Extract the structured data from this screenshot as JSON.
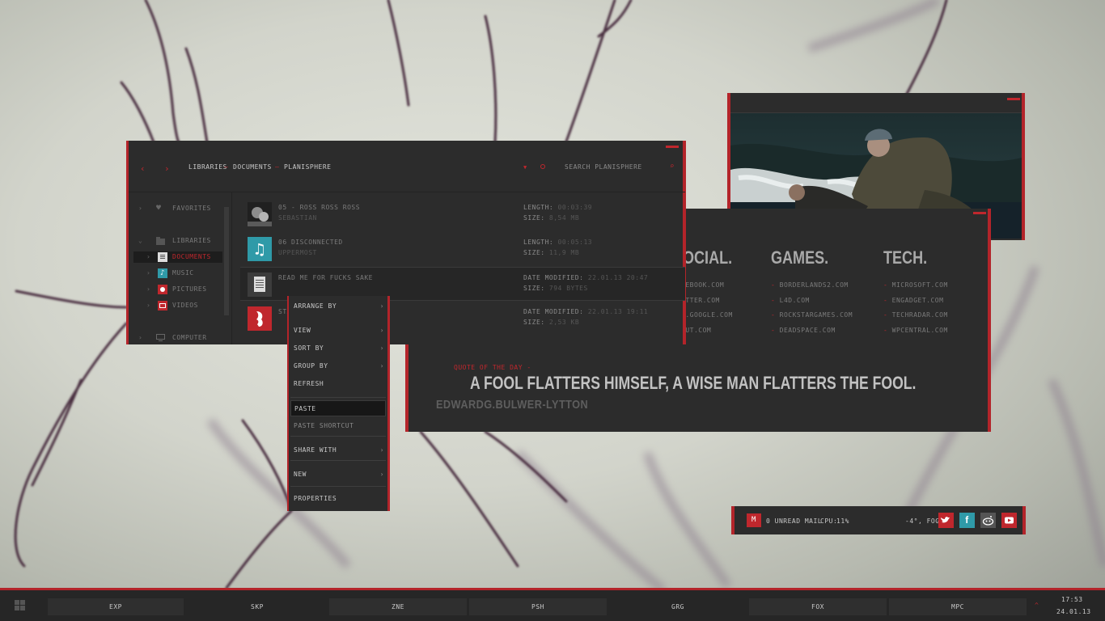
{
  "explorer": {
    "nav_back": "‹",
    "nav_forward": "›",
    "breadcrumb": [
      "LIBRARIES",
      "DOCUMENTS",
      "PLANISPHERE"
    ],
    "breadcrumb_sep": "–",
    "search_label": "SEARCH PLANISPHERE",
    "sidebar": {
      "favorites": "FAVORITES",
      "libraries": "LIBRARIES",
      "documents": "DOCUMENTS",
      "music": "MUSIC",
      "pictures": "PICTURES",
      "videos": "VIDEOS",
      "computer": "COMPUTER"
    },
    "files": [
      {
        "name": "05 - ROSS ROSS ROSS",
        "sub": "SEBASTIAN",
        "k1": "LENGTH:",
        "v1": "00:03:39",
        "k2": "SIZE:",
        "v2": "8,54 MB",
        "icon": "album-art-icon"
      },
      {
        "name": "06 DISCONNECTED",
        "sub": "UPPERMOST",
        "k1": "LENGTH:",
        "v1": "00:05:13",
        "k2": "SIZE:",
        "v2": "11,9 MB",
        "icon": "music-file-icon"
      },
      {
        "name": "READ ME FOR FUCKS SAKE",
        "sub": "",
        "k1": "DATE MODIFIED:",
        "v1": "22.01.13 20:47",
        "k2": "SIZE:",
        "v2": "794 BYTES",
        "icon": "text-document-icon"
      },
      {
        "name": "STA",
        "sub": "",
        "k1": "DATE MODIFIED:",
        "v1": "22.01.13 19:11",
        "k2": "SIZE:",
        "v2": "2,53 KB",
        "icon": "app-file-icon"
      }
    ]
  },
  "context_menu": {
    "arrange_by": "ARRANGE BY",
    "view": "VIEW",
    "sort_by": "SORT BY",
    "group_by": "GROUP BY",
    "refresh": "REFRESH",
    "paste": "PASTE",
    "paste_shortcut": "PASTE SHORTCUT",
    "share_with": "SHARE WITH",
    "new": "NEW",
    "properties": "PROPERTIES",
    "submenu_arrow": "›"
  },
  "links_widget": {
    "columns": [
      {
        "heading": "OCIAL.",
        "links": [
          "CEBOOK.COM",
          "ITTER.COM",
          "S.GOOGLE.COM",
          "KUT.COM"
        ]
      },
      {
        "heading": "GAMES.",
        "links": [
          "BORDERLANDS2.COM",
          "L4D.COM",
          "ROCKSTARGAMES.COM",
          "DEADSPACE.COM"
        ]
      },
      {
        "heading": "TECH.",
        "links": [
          "MICROSOFT.COM",
          "ENGADGET.COM",
          "TECHRADAR.COM",
          "WPCENTRAL.COM"
        ]
      }
    ],
    "link_dash": "- ",
    "quote_label": "QUOTE OF THE DAY -",
    "quote_text": "A FOOL FLATTERS HIMSELF, A WISE MAN FLATTERS THE FOOL.",
    "quote_author": "EDWARDG.BULWER-LYTTON"
  },
  "status_bar": {
    "mail": "0 UNREAD MAIL",
    "cpu_label": "CPU:",
    "cpu_value": "11%",
    "weather": "-4°, FOG",
    "social_icons": [
      "twitter-icon",
      "facebook-icon",
      "reddit-icon",
      "youtube-icon"
    ]
  },
  "taskbar": {
    "tasks": [
      "EXP",
      "SKP",
      "ZNE",
      "PSH",
      "GRG",
      "FOX",
      "MPC"
    ],
    "time": "17:53",
    "date": "24.01.13",
    "tray_arrow": "^"
  },
  "colors": {
    "accent": "#c0272d",
    "window": "#2c2c2c",
    "taskbar": "#262626"
  }
}
